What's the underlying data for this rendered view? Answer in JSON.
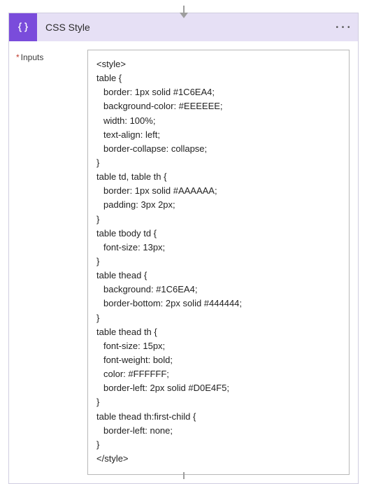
{
  "header": {
    "title": "CSS Style",
    "icon_name": "code-braces-icon",
    "menu_label": "• • •"
  },
  "body": {
    "input_label": "Inputs",
    "required_mark": "*",
    "code_lines": [
      "<style>",
      "table {",
      "  border: 1px solid #1C6EA4;",
      "  background-color: #EEEEEE;",
      "  width: 100%;",
      "  text-align: left;",
      "  border-collapse: collapse;",
      "}",
      "table td, table th {",
      "  border: 1px solid #AAAAAA;",
      "  padding: 3px 2px;",
      "}",
      "table tbody td {",
      "  font-size: 13px;",
      "}",
      "table thead {",
      "  background: #1C6EA4;",
      "  border-bottom: 2px solid #444444;",
      "}",
      "table thead th {",
      "  font-size: 15px;",
      "  font-weight: bold;",
      "  color: #FFFFFF;",
      "  border-left: 2px solid #D0E4F5;",
      "}",
      "table thead th:first-child {",
      "  border-left: none;",
      "}",
      "</style>"
    ]
  }
}
